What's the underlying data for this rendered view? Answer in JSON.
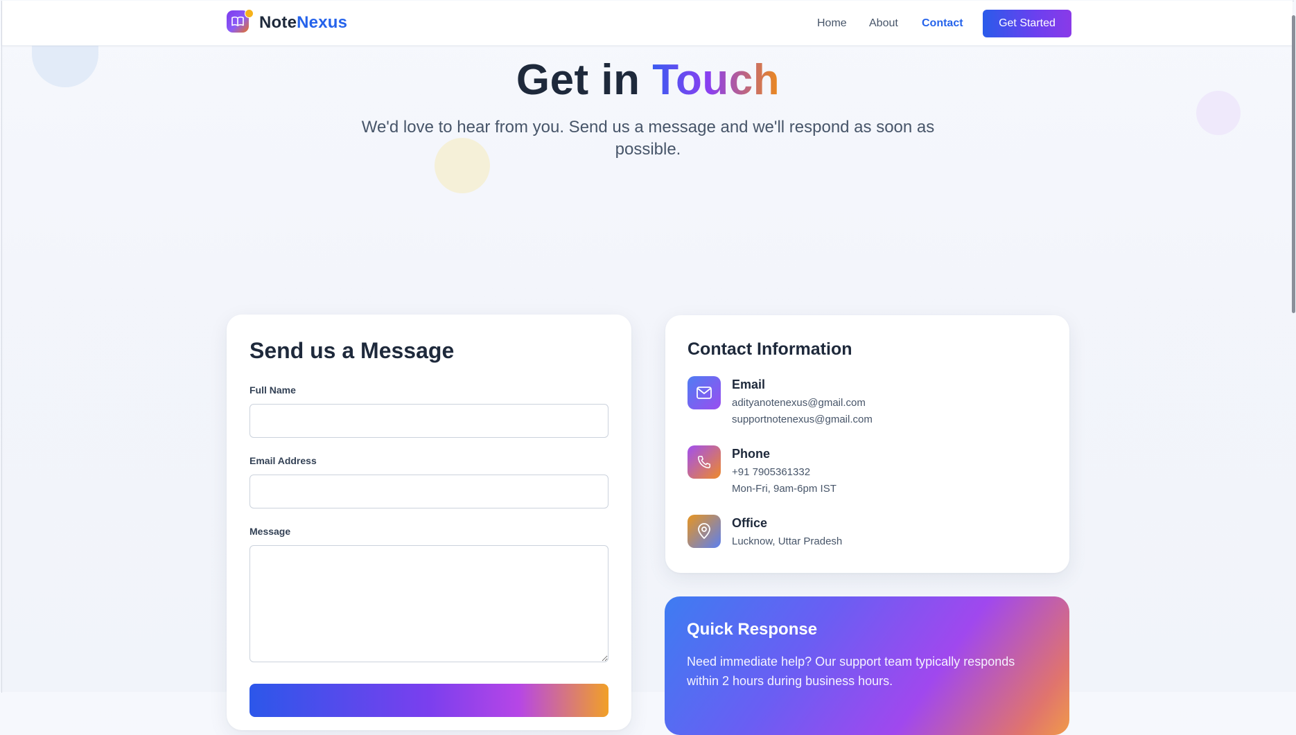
{
  "nav": {
    "brand_part1": "Note",
    "brand_part2": "Nexus",
    "logo_icon": "book-open-icon",
    "links": [
      "Home",
      "About",
      "Contact"
    ],
    "active_link": "Contact",
    "cta_label": "Get Started"
  },
  "hero": {
    "title_plain": "Get in",
    "title_accent": "Touch",
    "subtitle": "We'd love to hear from you. Send us a message and we'll respond as soon as possible."
  },
  "form": {
    "title": "Send us a Message",
    "name_label": "Full Name",
    "name_value": "",
    "email_label": "Email Address",
    "email_value": "",
    "message_label": "Message",
    "message_value": ""
  },
  "contact_info": {
    "title": "Contact Information",
    "items": [
      {
        "icon": "mail-icon",
        "heading": "Email",
        "lines": [
          "adityanotenexus@gmail.com",
          "supportnotenexus@gmail.com"
        ]
      },
      {
        "icon": "phone-icon",
        "heading": "Phone",
        "lines": [
          "+91 7905361332",
          "Mon-Fri, 9am-6pm IST"
        ]
      },
      {
        "icon": "map-pin-icon",
        "heading": "Office",
        "lines": [
          "Lucknow, Uttar Pradesh"
        ]
      }
    ]
  },
  "quick": {
    "title": "Quick Response",
    "text": "Need immediate help? Our support team typically responds within 2 hours during business hours."
  },
  "colors": {
    "primary": "#2563eb",
    "accent_purple": "#8b5cf6",
    "accent_orange": "#f59e0b",
    "text_dark": "#1e293b"
  }
}
